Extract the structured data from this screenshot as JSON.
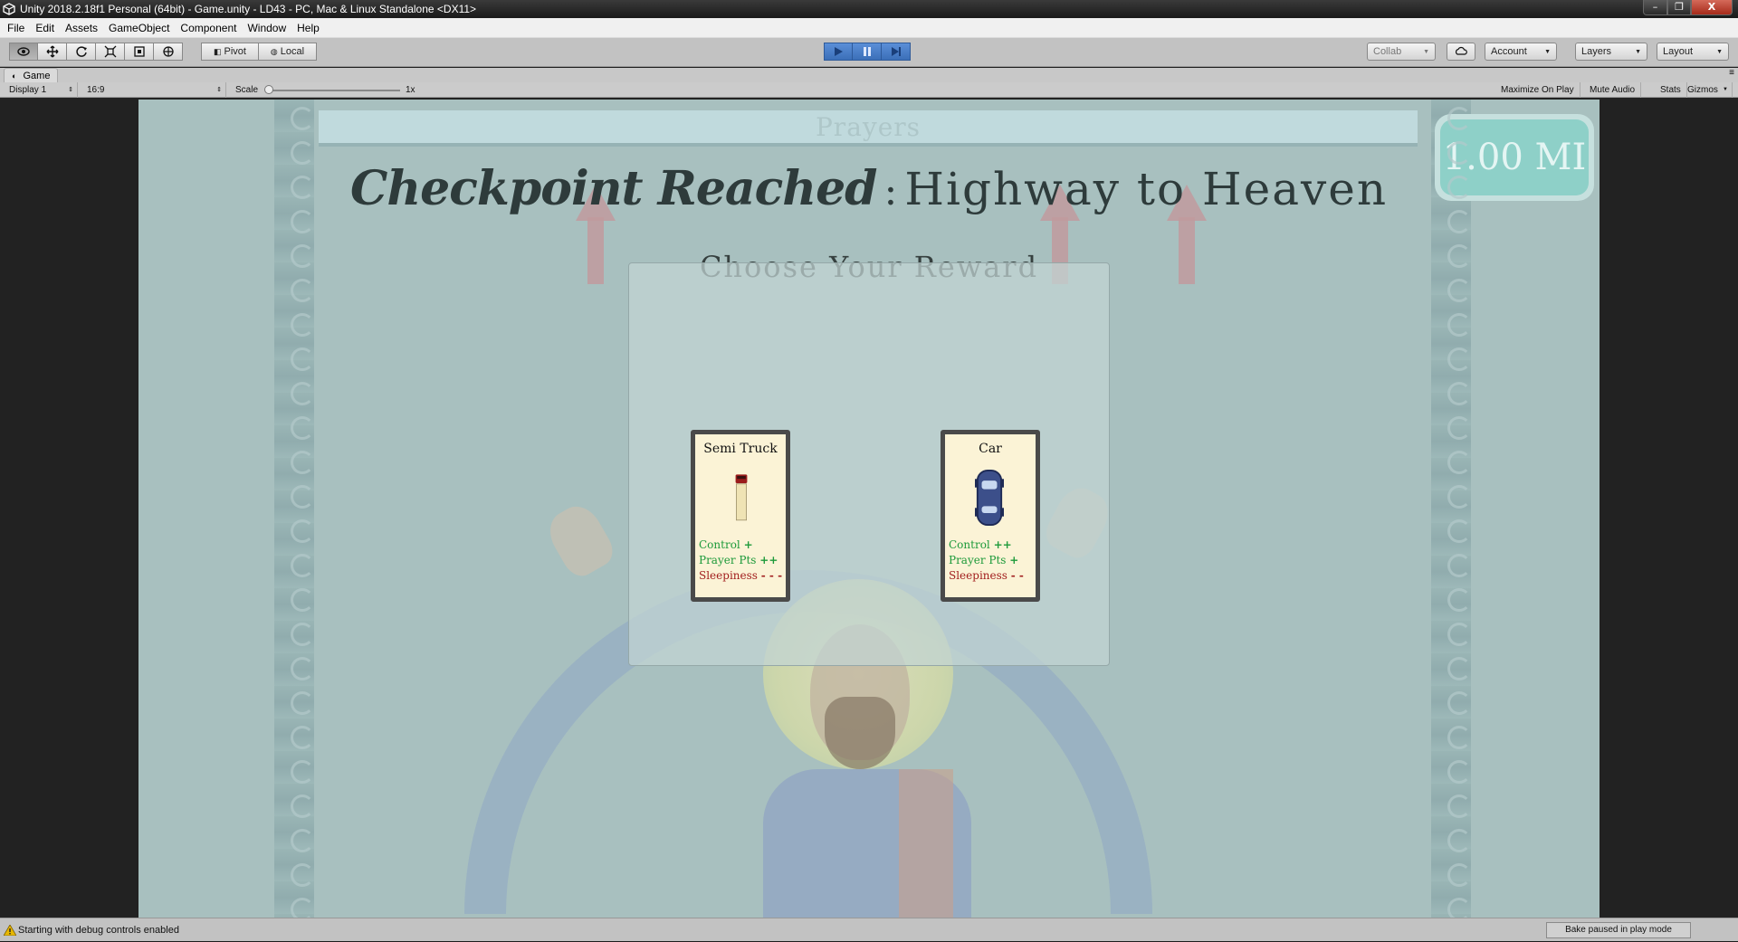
{
  "window": {
    "title": "Unity 2018.2.18f1 Personal (64bit) - Game.unity - LD43 - PC, Mac & Linux Standalone <DX11>",
    "minimize_label": "–",
    "maximize_label": "❐",
    "close_label": "X"
  },
  "menu": [
    "File",
    "Edit",
    "Assets",
    "GameObject",
    "Component",
    "Window",
    "Help"
  ],
  "toolbar": {
    "pivot_label": "Pivot",
    "local_label": "Local",
    "collab_label": "Collab",
    "account_label": "Account",
    "layers_label": "Layers",
    "layout_label": "Layout"
  },
  "game_tab": {
    "label": "Game",
    "display": "Display 1",
    "aspect": "16:9",
    "scale_label": "Scale",
    "scale_value": "1x",
    "maximize_on_play": "Maximize On Play",
    "mute_audio": "Mute Audio",
    "stats": "Stats",
    "gizmos": "Gizmos"
  },
  "game": {
    "prayers_label": "Prayers",
    "distance": "1.00 MI",
    "checkpoint_label": "Checkpoint Reached",
    "separator": ":",
    "location": "Highway to Heaven",
    "subtitle": "Choose Your Reward",
    "rewards": [
      {
        "name": "Semi Truck",
        "stats": [
          {
            "label": "Control",
            "sign": "+",
            "tone": "green"
          },
          {
            "label": "Prayer Pts",
            "sign": "++",
            "tone": "green"
          },
          {
            "label": "Sleepiness",
            "sign": "- - -",
            "tone": "red"
          }
        ]
      },
      {
        "name": "Car",
        "stats": [
          {
            "label": "Control",
            "sign": "++",
            "tone": "green"
          },
          {
            "label": "Prayer Pts",
            "sign": "+",
            "tone": "green"
          },
          {
            "label": "Sleepiness",
            "sign": "- -",
            "tone": "red"
          }
        ]
      }
    ]
  },
  "status": {
    "message": "Starting with debug controls enabled",
    "bake": "Bake paused in play mode"
  },
  "colors": {
    "accent_play": "#3b6fb8",
    "stat_green": "#1d9a3a",
    "stat_red": "#a11d1d",
    "distance_badge": "#8ed0c8"
  },
  "icons": [
    "unity-icon",
    "view-tool-icon",
    "move-tool-icon",
    "rotate-tool-icon",
    "scale-tool-icon",
    "rect-tool-icon",
    "transform-tool-icon",
    "play-icon",
    "pause-icon",
    "step-icon",
    "cloud-icon",
    "warning-icon",
    "semi-truck-icon",
    "car-icon"
  ]
}
